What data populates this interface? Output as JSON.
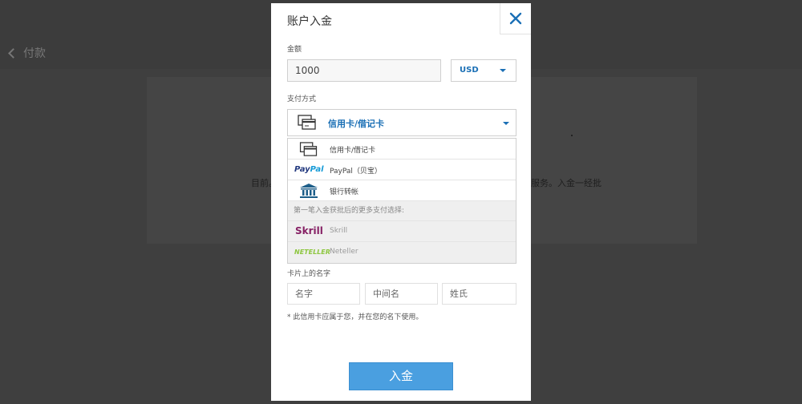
{
  "background": {
    "back_label": "付款",
    "text_left": "目前。",
    "text_right": "服务。入金一经批"
  },
  "modal": {
    "title": "账户入金",
    "close_icon": "close-icon",
    "amount": {
      "label": "金额",
      "value": "1000",
      "currency": "USD"
    },
    "payment_method": {
      "label": "支付方式",
      "selected": "信用卡/借记卡",
      "options": [
        {
          "label": "信用卡/借记卡",
          "icon": "credit-card-icon"
        },
        {
          "label": "PayPal（贝宝）",
          "icon": "paypal-logo",
          "logo_text_a": "Pay",
          "logo_text_b": "Pal"
        },
        {
          "label": "银行转帐",
          "icon": "bank-icon"
        }
      ],
      "more_header": "第一笔入金获批后的更多支付选择:",
      "more_options": [
        {
          "label": "Skrill",
          "logo_text": "Skrill"
        },
        {
          "label": "Neteller",
          "logo_text": "NETELLER"
        }
      ]
    },
    "card_name": {
      "label": "卡片上的名字",
      "first_placeholder": "名字",
      "middle_placeholder": "中间名",
      "last_placeholder": "姓氏"
    },
    "note": "* 此信用卡应属于您，并在您的名下使用。",
    "submit_label": "入金"
  },
  "colors": {
    "accent": "#1a6fb5",
    "button": "#4a9fe0",
    "overlay": "#3f3f3f"
  }
}
